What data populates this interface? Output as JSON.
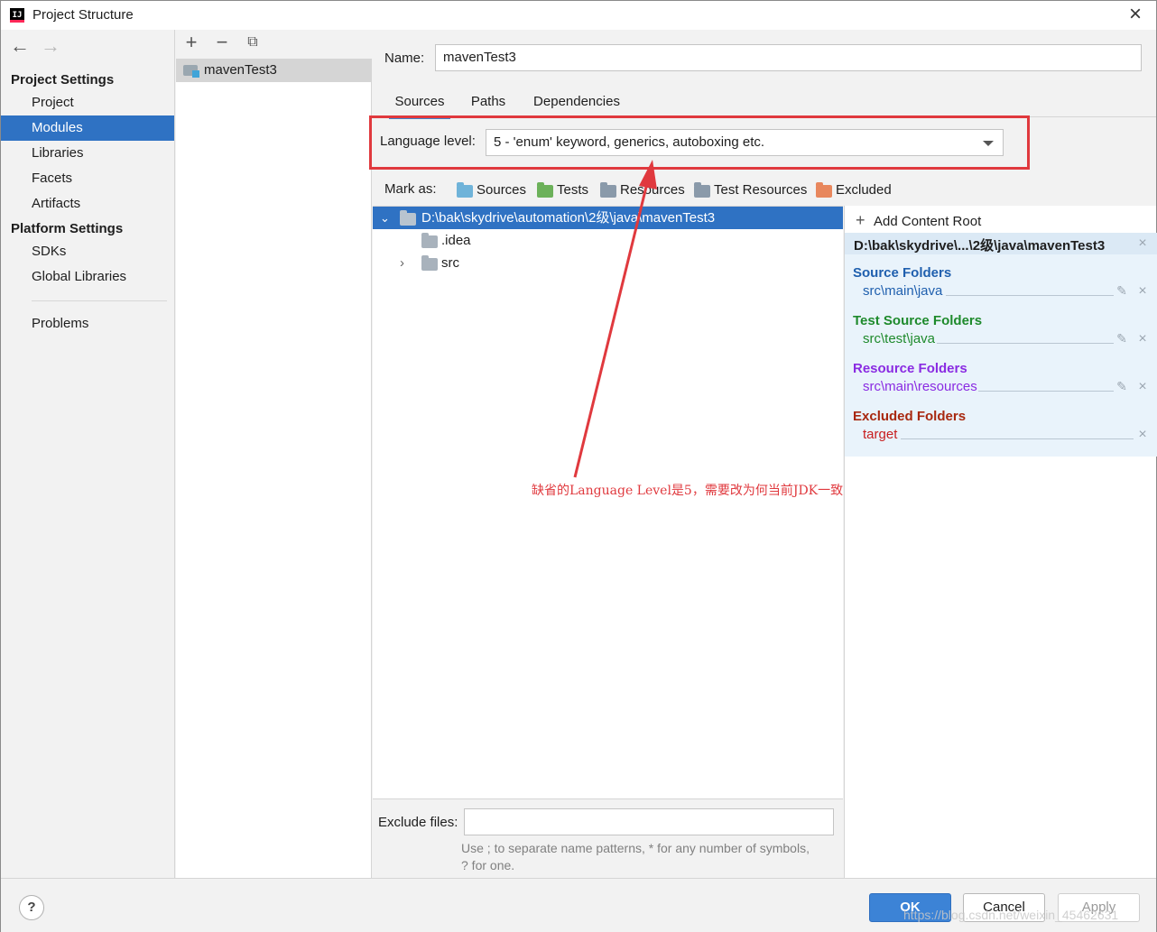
{
  "window": {
    "title": "Project Structure",
    "app_icon_text": "IJ"
  },
  "nav": {
    "project_settings_header": "Project Settings",
    "project_items": [
      "Project",
      "Modules",
      "Libraries",
      "Facets",
      "Artifacts"
    ],
    "selected": "Modules",
    "platform_settings_header": "Platform Settings",
    "platform_items": [
      "SDKs",
      "Global Libraries"
    ],
    "problems": "Problems"
  },
  "module_list": {
    "items": [
      "mavenTest3"
    ]
  },
  "module": {
    "name_label": "Name:",
    "name_value": "mavenTest3",
    "tabs": [
      "Sources",
      "Paths",
      "Dependencies"
    ],
    "active_tab": "Sources",
    "language_level_label": "Language level:",
    "language_level_value": "5 - 'enum' keyword, generics, autoboxing etc.",
    "mark_as_label": "Mark as:",
    "mark_as": [
      {
        "label": "Sources",
        "color": "#6fb3d9"
      },
      {
        "label": "Tests",
        "color": "#6cb15a"
      },
      {
        "label": "Resources",
        "color": "#8a9aaa"
      },
      {
        "label": "Test Resources",
        "color": "#8a9aaa"
      },
      {
        "label": "Excluded",
        "color": "#e8875d"
      }
    ]
  },
  "tree": {
    "root": "D:\\bak\\skydrive\\automation\\2级\\java\\mavenTest3",
    "children": [
      ".idea",
      "src"
    ]
  },
  "content_roots": {
    "add_label": "Add Content Root",
    "root_path": "D:\\bak\\skydrive\\...\\2级\\java\\mavenTest3",
    "source_title": "Source Folders",
    "source_path": "src\\main\\java",
    "test_title": "Test Source Folders",
    "test_path": "src\\test\\java",
    "resource_title": "Resource Folders",
    "resource_path": "src\\main\\resources",
    "excluded_title": "Excluded Folders",
    "excluded_path": "target",
    "colors": {
      "source": "#1f5fae",
      "test": "#1e8a2c",
      "resource": "#8a2be2",
      "excluded": "#a8280f",
      "excluded_path": "#c81e1e"
    }
  },
  "exclude": {
    "label": "Exclude files:",
    "value": "",
    "hint_line1": "Use ; to separate name patterns, * for any number of symbols,",
    "hint_line2": "? for one."
  },
  "annotation": {
    "text": "缺省的Language Level是5，需要改为何当前JDK一致"
  },
  "buttons": {
    "help": "?",
    "ok": "OK",
    "cancel": "Cancel",
    "apply": "Apply"
  },
  "watermark": "https://blog.csdn.net/weixin_45462631"
}
